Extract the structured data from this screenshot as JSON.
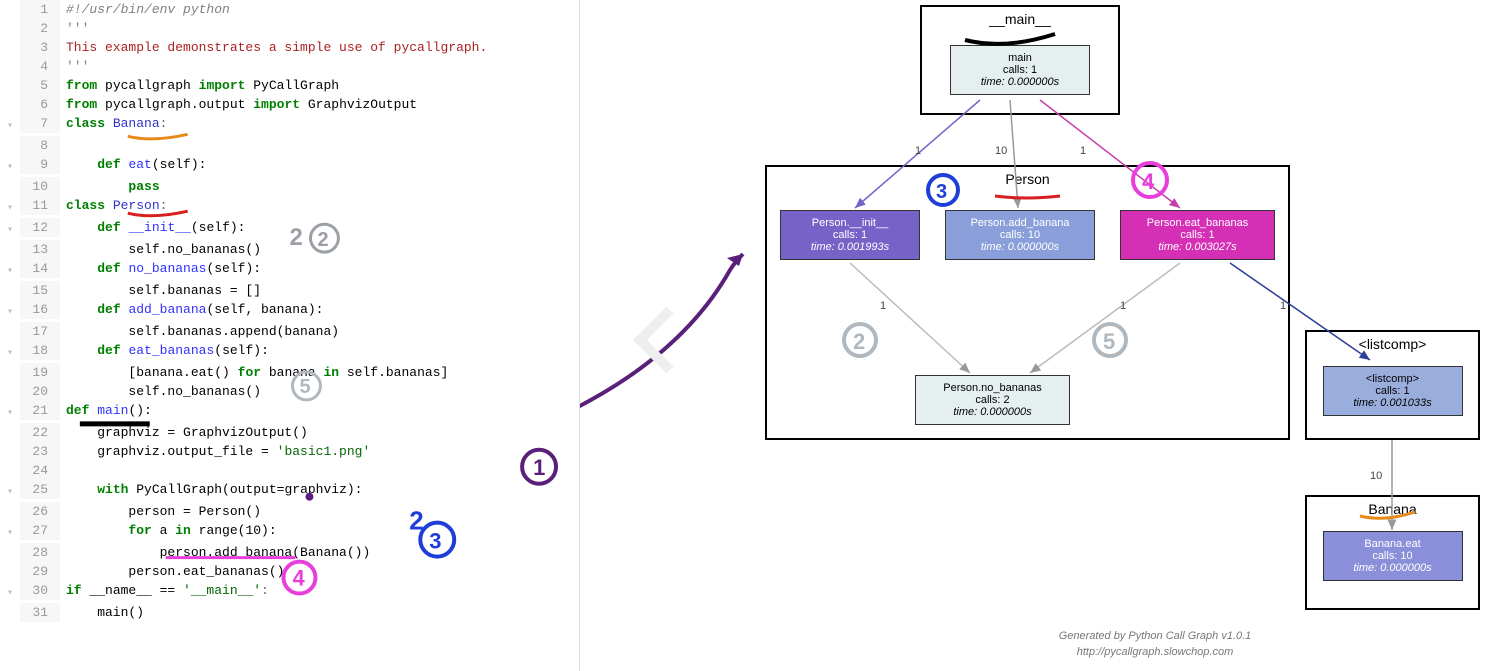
{
  "code": {
    "lines": [
      {
        "n": 1,
        "fold": "",
        "tokens": [
          [
            "cmt",
            "#!/usr/bin/env python"
          ]
        ]
      },
      {
        "n": 2,
        "fold": "",
        "tokens": [
          [
            "qq",
            "'''"
          ]
        ]
      },
      {
        "n": 3,
        "fold": "",
        "tokens": [
          [
            "doc",
            "This example demonstrates a simple use of pycallgraph."
          ]
        ]
      },
      {
        "n": 4,
        "fold": "",
        "tokens": [
          [
            "qq",
            "'''"
          ]
        ]
      },
      {
        "n": 5,
        "fold": "",
        "tokens": [
          [
            "kw-green",
            "from"
          ],
          [
            "lit",
            " pycallgraph "
          ],
          [
            "kw-green",
            "import"
          ],
          [
            "lit",
            " PyCallGraph"
          ]
        ]
      },
      {
        "n": 6,
        "fold": "",
        "tokens": [
          [
            "kw-green",
            "from"
          ],
          [
            "lit",
            " pycallgraph.output "
          ],
          [
            "kw-green",
            "import"
          ],
          [
            "lit",
            " GraphvizOutput"
          ]
        ]
      },
      {
        "n": 7,
        "fold": "▾",
        "tokens": [
          [
            "kw-green",
            "class"
          ],
          [
            "lit",
            " "
          ],
          [
            "cls-name",
            "Banana"
          ],
          [
            "op",
            ":"
          ]
        ]
      },
      {
        "n": 8,
        "fold": "",
        "tokens": [
          [
            "lit",
            ""
          ]
        ]
      },
      {
        "n": 9,
        "fold": "▾",
        "tokens": [
          [
            "lit",
            "    "
          ],
          [
            "kw-green",
            "def"
          ],
          [
            "lit",
            " "
          ],
          [
            "fn-name",
            "eat"
          ],
          [
            "lit",
            "(self):"
          ]
        ]
      },
      {
        "n": 10,
        "fold": "",
        "tokens": [
          [
            "lit",
            "        "
          ],
          [
            "kw-green",
            "pass"
          ]
        ]
      },
      {
        "n": 11,
        "fold": "▾",
        "tokens": [
          [
            "kw-green",
            "class"
          ],
          [
            "lit",
            " "
          ],
          [
            "cls-name",
            "Person"
          ],
          [
            "op",
            ":"
          ]
        ]
      },
      {
        "n": 12,
        "fold": "▾",
        "tokens": [
          [
            "lit",
            "    "
          ],
          [
            "kw-green",
            "def"
          ],
          [
            "lit",
            " "
          ],
          [
            "fn-name",
            "__init__"
          ],
          [
            "lit",
            "(self):"
          ]
        ]
      },
      {
        "n": 13,
        "fold": "",
        "tokens": [
          [
            "lit",
            "        self.no_bananas()"
          ]
        ]
      },
      {
        "n": 14,
        "fold": "▾",
        "tokens": [
          [
            "lit",
            "    "
          ],
          [
            "kw-green",
            "def"
          ],
          [
            "lit",
            " "
          ],
          [
            "fn-name",
            "no_bananas"
          ],
          [
            "lit",
            "(self):"
          ]
        ]
      },
      {
        "n": 15,
        "fold": "",
        "tokens": [
          [
            "lit",
            "        self.bananas = []"
          ]
        ]
      },
      {
        "n": 16,
        "fold": "▾",
        "tokens": [
          [
            "lit",
            "    "
          ],
          [
            "kw-green",
            "def"
          ],
          [
            "lit",
            " "
          ],
          [
            "fn-name",
            "add_banana"
          ],
          [
            "lit",
            "(self, banana):"
          ]
        ]
      },
      {
        "n": 17,
        "fold": "",
        "tokens": [
          [
            "lit",
            "        self.bananas.append(banana)"
          ]
        ]
      },
      {
        "n": 18,
        "fold": "▾",
        "tokens": [
          [
            "lit",
            "    "
          ],
          [
            "kw-green",
            "def"
          ],
          [
            "lit",
            " "
          ],
          [
            "fn-name",
            "eat_bananas"
          ],
          [
            "lit",
            "(self):"
          ]
        ]
      },
      {
        "n": 19,
        "fold": "",
        "tokens": [
          [
            "lit",
            "        [banana.eat() "
          ],
          [
            "kw-green",
            "for"
          ],
          [
            "lit",
            " banana "
          ],
          [
            "kw-green",
            "in"
          ],
          [
            "lit",
            " self.bananas]"
          ]
        ]
      },
      {
        "n": 20,
        "fold": "",
        "tokens": [
          [
            "lit",
            "        self.no_bananas()"
          ]
        ]
      },
      {
        "n": 21,
        "fold": "▾",
        "tokens": [
          [
            "kw-green",
            "def"
          ],
          [
            "lit",
            " "
          ],
          [
            "fn-name",
            "main"
          ],
          [
            "lit",
            "():"
          ]
        ]
      },
      {
        "n": 22,
        "fold": "",
        "tokens": [
          [
            "lit",
            "    graphviz = GraphvizOutput()"
          ]
        ]
      },
      {
        "n": 23,
        "fold": "",
        "tokens": [
          [
            "lit",
            "    graphviz.output_file = "
          ],
          [
            "str",
            "'basic1.png'"
          ]
        ]
      },
      {
        "n": 24,
        "fold": "",
        "tokens": [
          [
            "lit",
            ""
          ]
        ]
      },
      {
        "n": 25,
        "fold": "▾",
        "tokens": [
          [
            "lit",
            "    "
          ],
          [
            "kw-green",
            "with"
          ],
          [
            "lit",
            " PyCallGraph(output=graphviz):"
          ]
        ]
      },
      {
        "n": 26,
        "fold": "",
        "tokens": [
          [
            "lit",
            "        person = Person()"
          ]
        ]
      },
      {
        "n": 27,
        "fold": "▾",
        "tokens": [
          [
            "lit",
            "        "
          ],
          [
            "kw-green",
            "for"
          ],
          [
            "lit",
            " a "
          ],
          [
            "kw-green",
            "in"
          ],
          [
            "lit",
            " range(10):"
          ]
        ]
      },
      {
        "n": 28,
        "fold": "",
        "tokens": [
          [
            "lit",
            "            person.add_banana(Banana())"
          ]
        ]
      },
      {
        "n": 29,
        "fold": "",
        "tokens": [
          [
            "lit",
            "        person.eat_bananas()"
          ]
        ]
      },
      {
        "n": 30,
        "fold": "▾",
        "tokens": [
          [
            "kw-green",
            "if"
          ],
          [
            "lit",
            " __name__ == "
          ],
          [
            "str",
            "'__main__'"
          ],
          [
            "op",
            ":"
          ]
        ]
      },
      {
        "n": 31,
        "fold": "",
        "tokens": [
          [
            "lit",
            "    main()"
          ]
        ]
      }
    ]
  },
  "graph": {
    "clusters": {
      "main": {
        "label": "__main__"
      },
      "person": {
        "label": "Person"
      },
      "listcomp": {
        "label": "<listcomp>"
      },
      "banana": {
        "label": "Banana"
      }
    },
    "nodes": {
      "main": {
        "title": "main",
        "calls": "calls: 1",
        "time": "time: 0.000000s",
        "bg": "#e5efef"
      },
      "p_init": {
        "title": "Person.__init__",
        "calls": "calls: 1",
        "time": "time: 0.001993s",
        "bg": "#7762c8",
        "fg": "#fff"
      },
      "p_add": {
        "title": "Person.add_banana",
        "calls": "calls: 10",
        "time": "time: 0.000000s",
        "bg": "#8a9fd9",
        "fg": "#fff"
      },
      "p_eat": {
        "title": "Person.eat_bananas",
        "calls": "calls: 1",
        "time": "time: 0.003027s",
        "bg": "#d52fb6",
        "fg": "#fff"
      },
      "p_no": {
        "title": "Person.no_bananas",
        "calls": "calls: 2",
        "time": "time: 0.000000s",
        "bg": "#e5efef"
      },
      "listcomp": {
        "title": "<listcomp>",
        "calls": "calls: 1",
        "time": "time: 0.001033s",
        "bg": "#9aaedd",
        "fg": "#000"
      },
      "b_eat": {
        "title": "Banana.eat",
        "calls": "calls: 10",
        "time": "time: 0.000000s",
        "bg": "#8a8fd9",
        "fg": "#fff"
      }
    },
    "edge_labels": {
      "main_init": "1",
      "main_add": "10",
      "main_eat": "1",
      "init_no": "1",
      "eat_no": "1",
      "eat_list": "1",
      "list_ban": "10"
    },
    "footer1": "Generated by Python Call Graph v1.0.1",
    "footer2": "http://pycallgraph.slowchop.com"
  },
  "annotations": {
    "circle1": "1",
    "circle2a": "2",
    "circle2b": "2",
    "circle3a": "3",
    "circle3b": "3",
    "circle4a": "4",
    "circle4b": "4",
    "circle5a": "5",
    "circle5b": "5",
    "graph2": "2",
    "graph5": "5"
  }
}
